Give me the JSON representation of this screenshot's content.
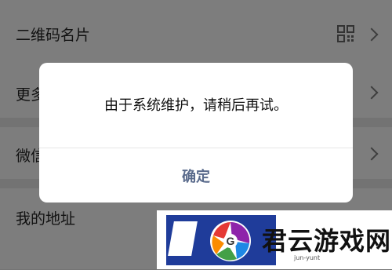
{
  "rows": [
    {
      "label": "二维码名片"
    },
    {
      "label": "更多"
    },
    {
      "label": "微信"
    },
    {
      "label": "我的地址"
    }
  ],
  "dialog": {
    "message": "由于系统维护，请稍后再试。",
    "ok_label": "确定"
  },
  "watermark": {
    "title": "君云游戏网",
    "subtitle": "jun-yunt",
    "logo_letter": "G"
  },
  "colors": {
    "dim_bg": "#7b7b7b",
    "dialog_bg": "#ffffff",
    "ok_text": "#5a6b8c",
    "watermark_blue": "#1f3c9a"
  }
}
